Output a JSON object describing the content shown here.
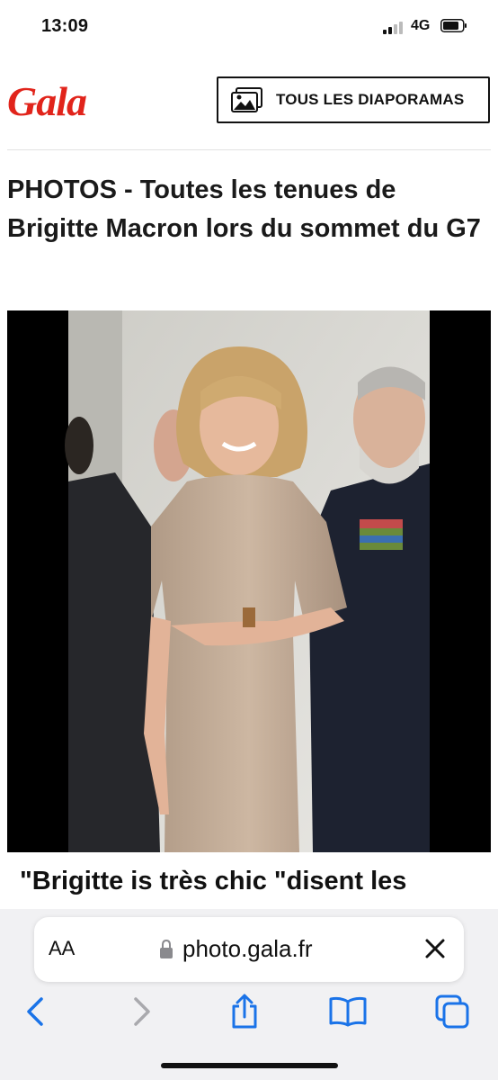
{
  "status_bar": {
    "time": "13:09",
    "network": "4G"
  },
  "header": {
    "brand": "Gala",
    "diaporamas_label": "TOUS LES DIAPORAMAS"
  },
  "article": {
    "title": "PHOTOS - Toutes les tenues de Brigitte Macron lors du sommet du G7",
    "caption": "\"Brigitte is très chic \"disent les"
  },
  "browser": {
    "text_size_label": "AA",
    "url": "photo.gala.fr",
    "icons": [
      "back-icon",
      "forward-icon",
      "share-icon",
      "bookmarks-icon",
      "tabs-icon"
    ]
  },
  "colors": {
    "brand_red": "#e1241b",
    "ios_blue": "#1a73e8"
  }
}
